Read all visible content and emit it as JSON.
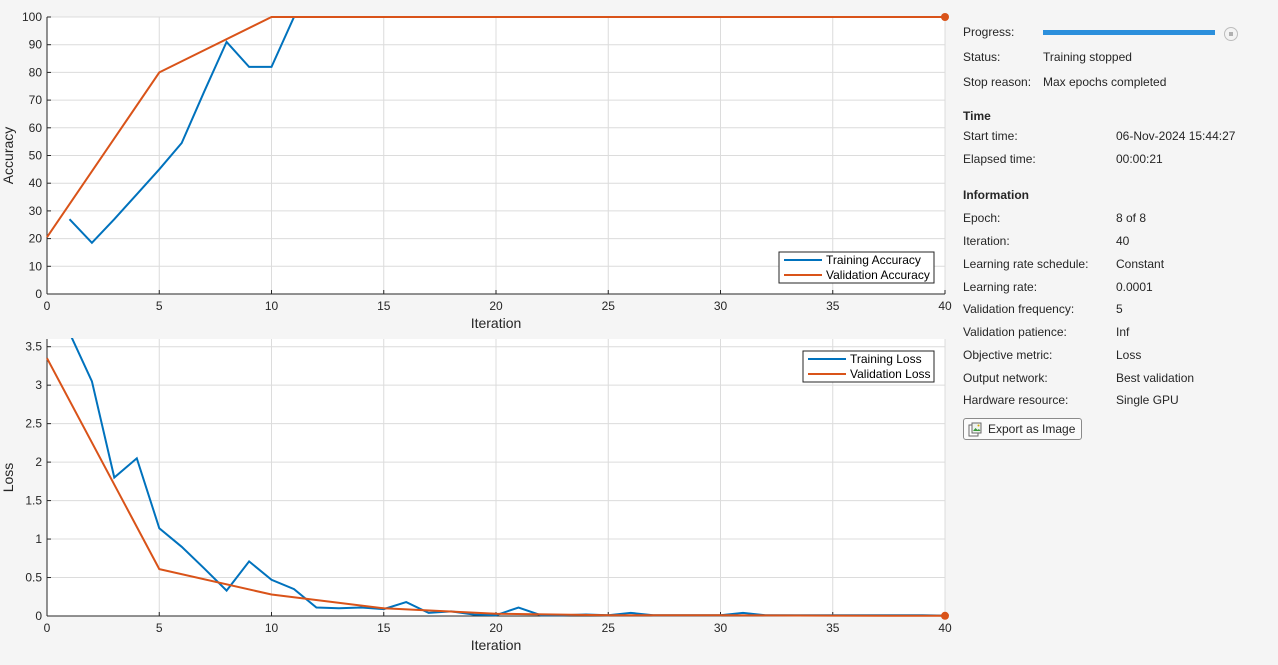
{
  "sidebar": {
    "progress": {
      "label": "Progress:",
      "fraction": 1.0
    },
    "status": {
      "label": "Status:",
      "value": "Training stopped"
    },
    "stop_reason": {
      "label": "Stop reason:",
      "value": "Max epochs completed"
    },
    "time": {
      "heading": "Time",
      "start": {
        "label": "Start time:",
        "value": "06-Nov-2024 15:44:27"
      },
      "elapsed": {
        "label": "Elapsed time:",
        "value": "00:00:21"
      }
    },
    "information": {
      "heading": "Information",
      "rows": [
        {
          "label": "Epoch:",
          "value": "8 of 8"
        },
        {
          "label": "Iteration:",
          "value": "40"
        },
        {
          "label": "Learning rate schedule:",
          "value": "Constant"
        },
        {
          "label": "Learning rate:",
          "value": "0.0001"
        },
        {
          "label": "Validation frequency:",
          "value": "5"
        },
        {
          "label": "Validation patience:",
          "value": "Inf"
        },
        {
          "label": "Objective metric:",
          "value": "Loss"
        },
        {
          "label": "Output network:",
          "value": "Best validation"
        },
        {
          "label": "Hardware resource:",
          "value": "Single GPU"
        }
      ]
    },
    "export_label": "Export as Image",
    "icons": {
      "stop": "stop-icon",
      "export": "export-image-icon"
    }
  },
  "colors": {
    "training": "#0072BD",
    "validation": "#D95319",
    "progress": "#2b8fdc"
  },
  "chart_data": [
    {
      "type": "line",
      "xlabel": "Iteration",
      "ylabel": "Accuracy",
      "xlim": [
        0,
        40
      ],
      "ylim": [
        0,
        100
      ],
      "xticks": [
        0,
        5,
        10,
        15,
        20,
        25,
        30,
        35,
        40
      ],
      "yticks": [
        0,
        10,
        20,
        30,
        40,
        50,
        60,
        70,
        80,
        90,
        100
      ],
      "grid": true,
      "legend_position": "bottom-right",
      "series": [
        {
          "name": "Training Accuracy",
          "color": "#0072BD",
          "points": [
            [
              1,
              27
            ],
            [
              2,
              18.5
            ],
            [
              3,
              27
            ],
            [
              4,
              36
            ],
            [
              5,
              45
            ],
            [
              6,
              54.5
            ],
            [
              7,
              73
            ],
            [
              8,
              91
            ],
            [
              9,
              82
            ],
            [
              10,
              82
            ],
            [
              11,
              100
            ],
            [
              40,
              100
            ]
          ]
        },
        {
          "name": "Validation Accuracy",
          "color": "#D95319",
          "marker_last": true,
          "points": [
            [
              0,
              20.5
            ],
            [
              5,
              80
            ],
            [
              10,
              100
            ],
            [
              15,
              100
            ],
            [
              20,
              100
            ],
            [
              25,
              100
            ],
            [
              30,
              100
            ],
            [
              35,
              100
            ],
            [
              40,
              100
            ]
          ]
        }
      ]
    },
    {
      "type": "line",
      "xlabel": "Iteration",
      "ylabel": "Loss",
      "xlim": [
        0,
        40
      ],
      "ylim": [
        0,
        3.6
      ],
      "xticks": [
        0,
        5,
        10,
        15,
        20,
        25,
        30,
        35,
        40
      ],
      "yticks": [
        0,
        0.5,
        1,
        1.5,
        2,
        2.5,
        3,
        3.5
      ],
      "grid": true,
      "legend_position": "top-right",
      "series": [
        {
          "name": "Training Loss",
          "color": "#0072BD",
          "points": [
            [
              1,
              3.68
            ],
            [
              2,
              3.05
            ],
            [
              3,
              1.8
            ],
            [
              4,
              2.05
            ],
            [
              5,
              1.14
            ],
            [
              6,
              0.9
            ],
            [
              7,
              0.62
            ],
            [
              8,
              0.33
            ],
            [
              9,
              0.71
            ],
            [
              10,
              0.47
            ],
            [
              11,
              0.35
            ],
            [
              12,
              0.11
            ],
            [
              13,
              0.1
            ],
            [
              14,
              0.11
            ],
            [
              15,
              0.09
            ],
            [
              16,
              0.18
            ],
            [
              17,
              0.04
            ],
            [
              18,
              0.06
            ],
            [
              19,
              0.02
            ],
            [
              20,
              0.01
            ],
            [
              21,
              0.11
            ],
            [
              22,
              0.01
            ],
            [
              23,
              0.01
            ],
            [
              24,
              0.02
            ],
            [
              25,
              0.01
            ],
            [
              26,
              0.04
            ],
            [
              27,
              0.01
            ],
            [
              28,
              0.01
            ],
            [
              29,
              0.01
            ],
            [
              30,
              0.01
            ],
            [
              31,
              0.04
            ],
            [
              32,
              0.01
            ],
            [
              33,
              0.01
            ],
            [
              34,
              0.01
            ],
            [
              35,
              0.01
            ],
            [
              36,
              0.01
            ],
            [
              37,
              0.01
            ],
            [
              38,
              0.01
            ],
            [
              39,
              0.01
            ],
            [
              40,
              0.005
            ]
          ]
        },
        {
          "name": "Validation Loss",
          "color": "#D95319",
          "marker_last": true,
          "points": [
            [
              0,
              3.35
            ],
            [
              5,
              0.61
            ],
            [
              10,
              0.28
            ],
            [
              15,
              0.1
            ],
            [
              20,
              0.03
            ],
            [
              25,
              0.01
            ],
            [
              30,
              0.01
            ],
            [
              35,
              0.005
            ],
            [
              40,
              0.003
            ]
          ]
        }
      ]
    }
  ]
}
